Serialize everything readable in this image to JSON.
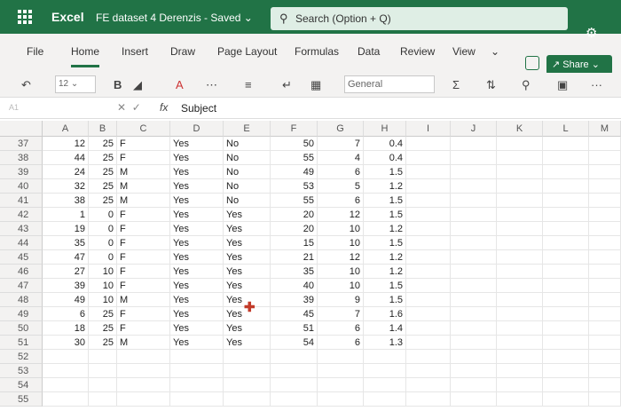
{
  "titlebar": {
    "app_name": "Excel",
    "doc_title": "FE dataset 4 Derenzis  -  Saved ⌄",
    "search_placeholder": "Search (Option + Q)"
  },
  "tabs": [
    "File",
    "Home",
    "Insert",
    "Draw",
    "Page Layout",
    "Formulas",
    "Data",
    "Review",
    "View"
  ],
  "active_tab": "Home",
  "share_label": "Share",
  "toolbar": {
    "font_size": "12",
    "bold": "B",
    "number_format": "General",
    "more": "···"
  },
  "formula_bar": {
    "name_box": "A1",
    "fx": "fx",
    "value": "Subject"
  },
  "columns": [
    "A",
    "B",
    "C",
    "D",
    "E",
    "F",
    "G",
    "H",
    "I",
    "J",
    "K",
    "L",
    "M"
  ],
  "rows": [
    {
      "n": "37",
      "a": "12",
      "b": "25",
      "c": "F",
      "d": "Yes",
      "e": "No",
      "f": "50",
      "g": "7",
      "h": "0.4"
    },
    {
      "n": "38",
      "a": "44",
      "b": "25",
      "c": "F",
      "d": "Yes",
      "e": "No",
      "f": "55",
      "g": "4",
      "h": "0.4"
    },
    {
      "n": "39",
      "a": "24",
      "b": "25",
      "c": "M",
      "d": "Yes",
      "e": "No",
      "f": "49",
      "g": "6",
      "h": "1.5"
    },
    {
      "n": "40",
      "a": "32",
      "b": "25",
      "c": "M",
      "d": "Yes",
      "e": "No",
      "f": "53",
      "g": "5",
      "h": "1.2"
    },
    {
      "n": "41",
      "a": "38",
      "b": "25",
      "c": "M",
      "d": "Yes",
      "e": "No",
      "f": "55",
      "g": "6",
      "h": "1.5"
    },
    {
      "n": "42",
      "a": "1",
      "b": "0",
      "c": "F",
      "d": "Yes",
      "e": "Yes",
      "f": "20",
      "g": "12",
      "h": "1.5"
    },
    {
      "n": "43",
      "a": "19",
      "b": "0",
      "c": "F",
      "d": "Yes",
      "e": "Yes",
      "f": "20",
      "g": "10",
      "h": "1.2"
    },
    {
      "n": "44",
      "a": "35",
      "b": "0",
      "c": "F",
      "d": "Yes",
      "e": "Yes",
      "f": "15",
      "g": "10",
      "h": "1.5"
    },
    {
      "n": "45",
      "a": "47",
      "b": "0",
      "c": "F",
      "d": "Yes",
      "e": "Yes",
      "f": "21",
      "g": "12",
      "h": "1.2"
    },
    {
      "n": "46",
      "a": "27",
      "b": "10",
      "c": "F",
      "d": "Yes",
      "e": "Yes",
      "f": "35",
      "g": "10",
      "h": "1.2"
    },
    {
      "n": "47",
      "a": "39",
      "b": "10",
      "c": "F",
      "d": "Yes",
      "e": "Yes",
      "f": "40",
      "g": "10",
      "h": "1.5"
    },
    {
      "n": "48",
      "a": "49",
      "b": "10",
      "c": "M",
      "d": "Yes",
      "e": "Yes",
      "f": "39",
      "g": "9",
      "h": "1.5"
    },
    {
      "n": "49",
      "a": "6",
      "b": "25",
      "c": "F",
      "d": "Yes",
      "e": "Yes",
      "f": "45",
      "g": "7",
      "h": "1.6"
    },
    {
      "n": "50",
      "a": "18",
      "b": "25",
      "c": "F",
      "d": "Yes",
      "e": "Yes",
      "f": "51",
      "g": "6",
      "h": "1.4"
    },
    {
      "n": "51",
      "a": "30",
      "b": "25",
      "c": "M",
      "d": "Yes",
      "e": "Yes",
      "f": "54",
      "g": "6",
      "h": "1.3"
    },
    {
      "n": "52",
      "a": "",
      "b": "",
      "c": "",
      "d": "",
      "e": "",
      "f": "",
      "g": "",
      "h": ""
    },
    {
      "n": "53",
      "a": "",
      "b": "",
      "c": "",
      "d": "",
      "e": "",
      "f": "",
      "g": "",
      "h": ""
    },
    {
      "n": "54",
      "a": "",
      "b": "",
      "c": "",
      "d": "",
      "e": "",
      "f": "",
      "g": "",
      "h": ""
    },
    {
      "n": "55",
      "a": "",
      "b": "",
      "c": "",
      "d": "",
      "e": "",
      "f": "",
      "g": "",
      "h": ""
    }
  ],
  "colors": {
    "accent": "#217346"
  }
}
